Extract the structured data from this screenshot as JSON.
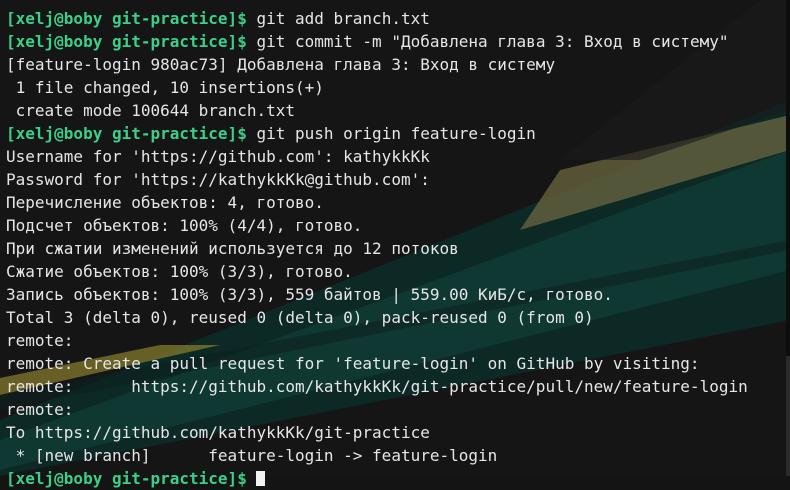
{
  "terminal": {
    "lines": [
      {
        "prompt": "[xelj@boby git-practice]$",
        "text": " git add branch.txt"
      },
      {
        "prompt": "[xelj@boby git-practice]$",
        "text": " git commit -m \"Добавлена глава 3: Вход в систему\""
      },
      {
        "prompt": "",
        "text": "[feature-login 980ac73] Добавлена глава 3: Вход в систему"
      },
      {
        "prompt": "",
        "text": " 1 file changed, 10 insertions(+)"
      },
      {
        "prompt": "",
        "text": " create mode 100644 branch.txt"
      },
      {
        "prompt": "[xelj@boby git-practice]$",
        "text": " git push origin feature-login"
      },
      {
        "prompt": "",
        "text": "Username for 'https://github.com': kathykkKk"
      },
      {
        "prompt": "",
        "text": "Password for 'https://kathykkKk@github.com':"
      },
      {
        "prompt": "",
        "text": "Перечисление объектов: 4, готово."
      },
      {
        "prompt": "",
        "text": "Подсчет объектов: 100% (4/4), готово."
      },
      {
        "prompt": "",
        "text": "При сжатии изменений используется до 12 потоков"
      },
      {
        "prompt": "",
        "text": "Сжатие объектов: 100% (3/3), готово."
      },
      {
        "prompt": "",
        "text": "Запись объектов: 100% (3/3), 559 байтов | 559.00 КиБ/с, готово."
      },
      {
        "prompt": "",
        "text": "Total 3 (delta 0), reused 0 (delta 0), pack-reused 0 (from 0)"
      },
      {
        "prompt": "",
        "text": "remote:"
      },
      {
        "prompt": "",
        "text": "remote: Create a pull request for 'feature-login' on GitHub by visiting:"
      },
      {
        "prompt": "",
        "text": "remote:      https://github.com/kathykkKk/git-practice/pull/new/feature-login"
      },
      {
        "prompt": "",
        "text": "remote:"
      },
      {
        "prompt": "",
        "text": "To https://github.com/kathykkKk/git-practice"
      },
      {
        "prompt": "",
        "text": " * [new branch]      feature-login -> feature-login"
      },
      {
        "prompt": "[xelj@boby git-practice]$",
        "text": " "
      }
    ]
  },
  "colors": {
    "prompt": "#3ad08a",
    "text": "#e6e6e6",
    "background": "#141414"
  }
}
